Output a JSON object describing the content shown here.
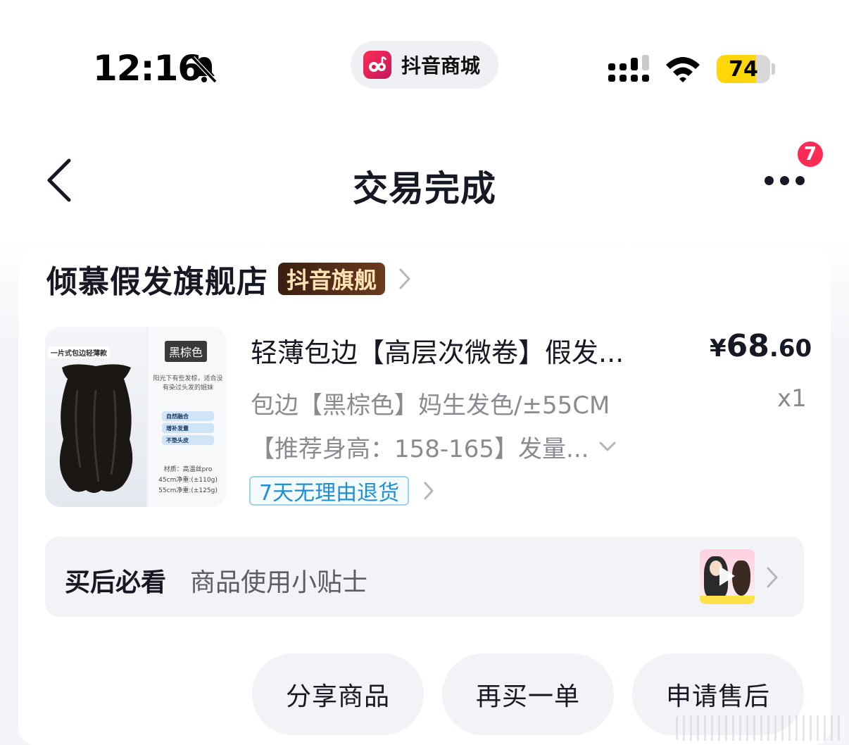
{
  "status_bar": {
    "time": "12:16",
    "app_name": "抖音商城",
    "battery": "74",
    "battery_level": 0.74,
    "icons": [
      "bell-off-icon",
      "signal-icon",
      "wifi-icon",
      "battery-icon"
    ]
  },
  "nav": {
    "title": "交易完成",
    "badge_count": "7",
    "icons": [
      "back-icon",
      "more-icon"
    ]
  },
  "store": {
    "name": "倾慕假发旗舰店",
    "tag": "抖音旗舰"
  },
  "product": {
    "title": "轻薄包边【高层次微卷】假发...",
    "price_currency": "¥",
    "price_int": "68",
    "price_dec": ".60",
    "spec_line1": "包边【黑棕色】妈生发色/±55CM",
    "spec_line2": "【推荐身高：158-165】发量...",
    "quantity": "x1",
    "return_policy": "7天无理由退货",
    "image": {
      "banner": "一片式包边轻薄款",
      "color": "黑棕色",
      "desc": "阳光下有些发棕，适合没有染过头发的姐妹",
      "features": [
        "自然融合",
        "增补发量",
        "不垫头皮"
      ],
      "spec_material": "材质：高温丝pro",
      "spec_45": "45cm净重:(±110g)",
      "spec_55": "55cm净重:(±125g)"
    }
  },
  "tips": {
    "title": "买后必看",
    "subtitle": "商品使用小贴士"
  },
  "actions": {
    "share": "分享商品",
    "rebuy": "再买一单",
    "after_sale": "申请售后"
  },
  "colors": {
    "accent_red": "#fe2c55",
    "return_blue": "#1f8fd1",
    "battery_yellow": "#ffd60a",
    "store_tag_bg": "#3a1e10"
  }
}
